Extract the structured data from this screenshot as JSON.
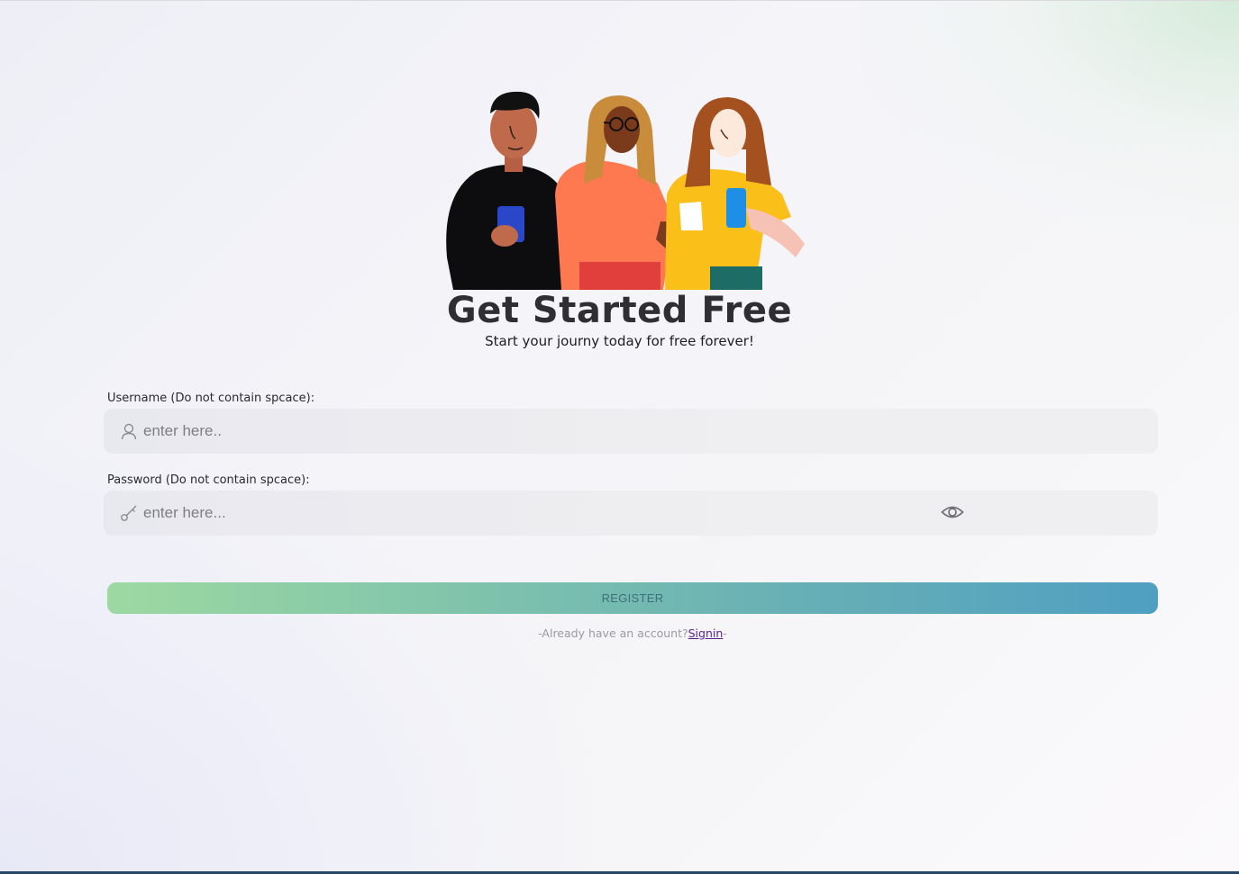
{
  "header": {
    "title": "Get Started Free",
    "subtitle": "Start your journy today for free forever!"
  },
  "form": {
    "username": {
      "label": "Username (Do not contain spcace):",
      "placeholder": "enter here..",
      "value": "",
      "icon": "user-icon"
    },
    "password": {
      "label": "Password (Do not contain spcace):",
      "placeholder": "enter here...",
      "value": "",
      "icon": "key-icon",
      "toggle_icon": "eye-icon"
    },
    "register_label": "REGISTER",
    "signin_prefix": "-Already have an account?",
    "signin_link": "Signin",
    "signin_suffix": "-"
  },
  "colors": {
    "button_gradient_start": "#9dd9a1",
    "button_gradient_end": "#4f9fc2",
    "link_color": "#5a1f8f",
    "title_color": "#2e2e33"
  }
}
